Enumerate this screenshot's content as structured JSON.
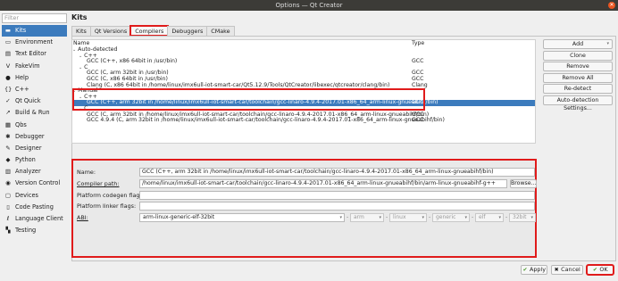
{
  "window": {
    "title": "Options — Qt Creator"
  },
  "filter": {
    "placeholder": "Filter"
  },
  "sidebar": {
    "items": [
      {
        "label": "Kits",
        "icon": "kits-icon",
        "glyph": "▬"
      },
      {
        "label": "Environment",
        "icon": "monitor-icon",
        "glyph": "▭"
      },
      {
        "label": "Text Editor",
        "icon": "text-editor-icon",
        "glyph": "▤"
      },
      {
        "label": "FakeVim",
        "icon": "vim-icon",
        "glyph": "V"
      },
      {
        "label": "Help",
        "icon": "help-icon",
        "glyph": "●"
      },
      {
        "label": "C++",
        "icon": "cpp-icon",
        "glyph": "{}"
      },
      {
        "label": "Qt Quick",
        "icon": "qt-quick-icon",
        "glyph": "✓"
      },
      {
        "label": "Build & Run",
        "icon": "build-run-icon",
        "glyph": "↗"
      },
      {
        "label": "Qbs",
        "icon": "qbs-icon",
        "glyph": "▦"
      },
      {
        "label": "Debugger",
        "icon": "debugger-icon",
        "glyph": "✱"
      },
      {
        "label": "Designer",
        "icon": "designer-icon",
        "glyph": "✎"
      },
      {
        "label": "Python",
        "icon": "python-icon",
        "glyph": "◆"
      },
      {
        "label": "Analyzer",
        "icon": "analyzer-icon",
        "glyph": "▥"
      },
      {
        "label": "Version Control",
        "icon": "version-control-icon",
        "glyph": "◉"
      },
      {
        "label": "Devices",
        "icon": "devices-icon",
        "glyph": "▢"
      },
      {
        "label": "Code Pasting",
        "icon": "code-pasting-icon",
        "glyph": "▯"
      },
      {
        "label": "Language Client",
        "icon": "language-client-icon",
        "glyph": "ℓ"
      },
      {
        "label": "Testing",
        "icon": "testing-icon",
        "glyph": "▚"
      }
    ]
  },
  "page": {
    "title": "Kits",
    "tabs": [
      "Kits",
      "Qt Versions",
      "Compilers",
      "Debuggers",
      "CMake"
    ]
  },
  "tree": {
    "columns": {
      "name": "Name",
      "type": "Type"
    },
    "auto_detected": "Auto-detected",
    "cpp": "C++",
    "c": "C",
    "manual": "Manual",
    "auto_cpp_rows": [
      {
        "name": "GCC (C++, x86 64bit in /usr/bin)",
        "type": "GCC"
      }
    ],
    "auto_c_rows": [
      {
        "name": "GCC (C, arm 32bit in /usr/bin)",
        "type": "GCC"
      },
      {
        "name": "GCC (C, x86 64bit in /usr/bin)",
        "type": "GCC"
      },
      {
        "name": "Clang (C, x86 64bit in /home/linux/imx6ull-iot-smart-car/Qt5.12.9/Tools/QtCreator/libexec/qtcreator/clang/bin)",
        "type": "Clang"
      }
    ],
    "manual_cpp_rows": [
      {
        "name": "GCC (C++, arm 32bit in /home/linux/imx6ull-iot-smart-car/toolchain/gcc-linaro-4.9.4-2017.01-x86_64_arm-linux-gnueabihf/bin)",
        "type": "GCC"
      }
    ],
    "manual_c_rows": [
      {
        "name": "GCC (C, arm 32bit in /home/linux/imx6ull-iot-smart-car/toolchain/gcc-linaro-4.9.4-2017.01-x86_64_arm-linux-gnueabihf/bin)",
        "type": "GCC"
      },
      {
        "name": "GCC 4.9.4 (C, arm 32bit in /home/linux/imx6ull-iot-smart-car/toolchain/gcc-linaro-4.9.4-2017.01-x86_64_arm-linux-gnueabihf/bin)",
        "type": "GCC"
      }
    ]
  },
  "buttons": {
    "add": "Add",
    "clone": "Clone",
    "remove": "Remove",
    "remove_all": "Remove All",
    "redetect": "Re-detect",
    "auto_detection": "Auto-detection Settings..."
  },
  "details": {
    "name_label": "Name:",
    "name_value": "GCC (C++, arm 32bit in /home/linux/imx6ull-iot-smart-car/toolchain/gcc-linaro-4.9.4-2017.01-x86_64_arm-linux-gnueabihf/bin)",
    "compiler_path_label": "Compiler path:",
    "compiler_path_value": "/home/linux/imx6ull-iot-smart-car/toolchain/gcc-linaro-4.9.4-2017.01-x86_64_arm-linux-gnueabihf/bin/arm-linux-gnueabihf-g++",
    "browse": "Browse...",
    "codegen_label": "Platform codegen flags:",
    "codegen_value": "",
    "linker_label": "Platform linker flags:",
    "linker_value": "",
    "abi_label": "ABI:",
    "abi_value": "arm-linux-generic-elf-32bit",
    "abi_parts": [
      "arm",
      "linux",
      "generic",
      "elf",
      "32bit"
    ]
  },
  "footer": {
    "apply": "Apply",
    "cancel": "Cancel",
    "ok": "OK"
  },
  "colors": {
    "selection": "#3c7bbd",
    "highlight": "#e01b1b",
    "titlebar": "#3c3b37"
  }
}
